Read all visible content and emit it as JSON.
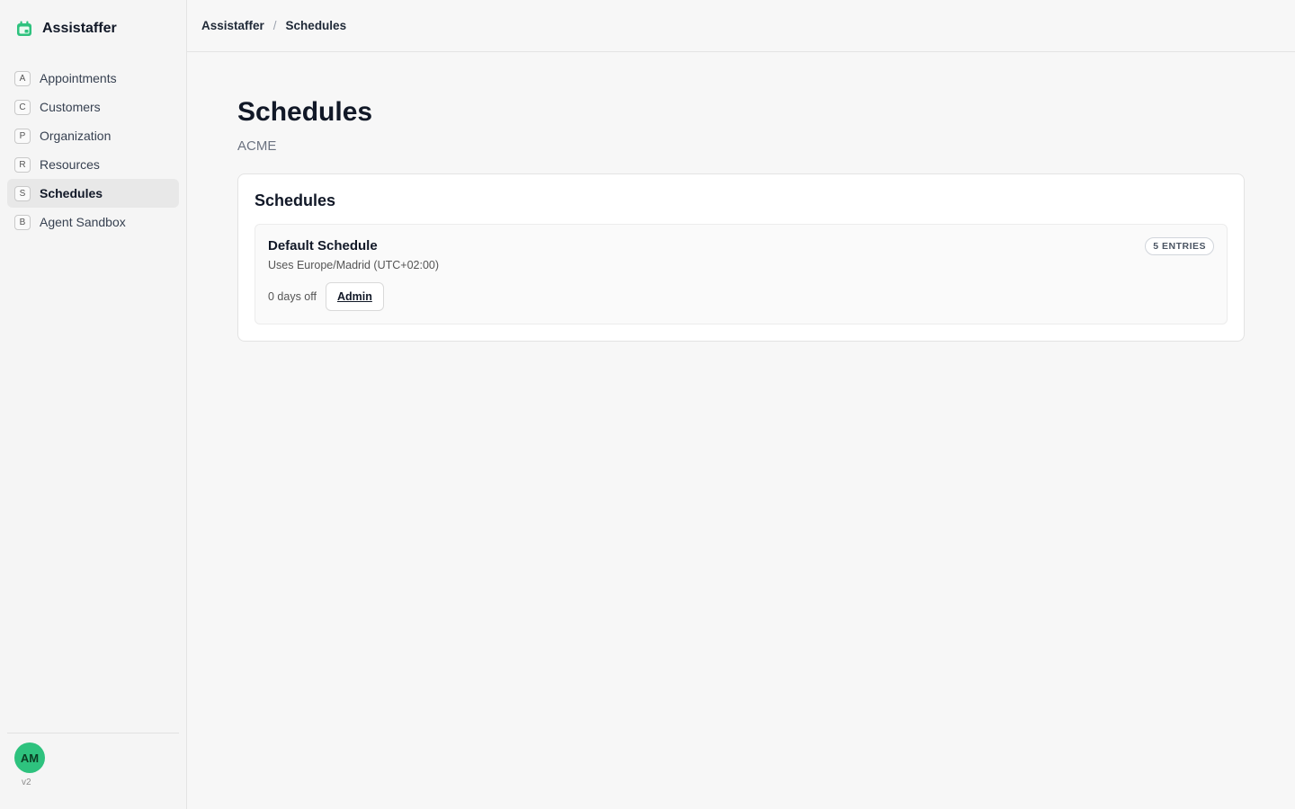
{
  "app": {
    "name": "Assistaffer",
    "brand_color": "#2ec27e"
  },
  "sidebar": {
    "items": [
      {
        "key": "A",
        "label": "Appointments",
        "active": false
      },
      {
        "key": "C",
        "label": "Customers",
        "active": false
      },
      {
        "key": "P",
        "label": "Organization",
        "active": false
      },
      {
        "key": "R",
        "label": "Resources",
        "active": false
      },
      {
        "key": "S",
        "label": "Schedules",
        "active": true
      },
      {
        "key": "B",
        "label": "Agent Sandbox",
        "active": false
      }
    ],
    "user_initials": "AM",
    "version": "v2"
  },
  "breadcrumb": {
    "root": "Assistaffer",
    "separator": "/",
    "current": "Schedules"
  },
  "page": {
    "title": "Schedules",
    "subtitle": "ACME"
  },
  "card": {
    "title": "Schedules",
    "schedule": {
      "name": "Default Schedule",
      "timezone": "Uses Europe/Madrid (UTC+02:00)",
      "entries_badge": "5 ENTRIES",
      "days_off": "0 days off",
      "admin_label": "Admin"
    }
  }
}
